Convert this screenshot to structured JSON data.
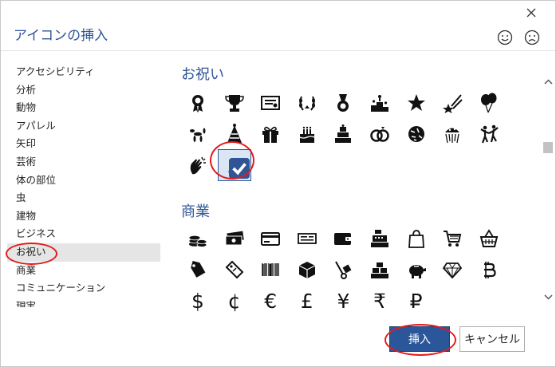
{
  "dialog": {
    "title": "アイコンの挿入",
    "close_icon": "close-icon",
    "feedback_positive_icon": "smile-icon",
    "feedback_negative_icon": "frown-icon"
  },
  "categories": [
    {
      "label": "アクセシビリティ",
      "selected": false
    },
    {
      "label": "分析",
      "selected": false
    },
    {
      "label": "動物",
      "selected": false
    },
    {
      "label": "アパレル",
      "selected": false
    },
    {
      "label": "矢印",
      "selected": false
    },
    {
      "label": "芸術",
      "selected": false
    },
    {
      "label": "体の部位",
      "selected": false
    },
    {
      "label": "虫",
      "selected": false
    },
    {
      "label": "建物",
      "selected": false
    },
    {
      "label": "ビジネス",
      "selected": false
    },
    {
      "label": "お祝い",
      "selected": true
    },
    {
      "label": "商業",
      "selected": false
    },
    {
      "label": "コミュニケーション",
      "selected": false
    },
    {
      "label": "現実",
      "selected": false
    }
  ],
  "sections": [
    {
      "title": "お祝い",
      "icons": [
        "rosette-icon",
        "trophy-icon",
        "certificate-icon",
        "laurel-wreath-icon",
        "medal-icon",
        "podium-icon",
        "star-icon",
        "shooting-star-icon",
        "balloons-icon",
        "balloon-dog-icon",
        "party-hat-icon",
        "gift-icon",
        "birthday-cake-icon",
        "wedding-cake-icon",
        "rings-icon",
        "confetti-icon",
        "confetti-ball-icon",
        "dancing-people-icon",
        "clapping-hands-icon",
        "party-popper-icon"
      ],
      "selected_index": 19
    },
    {
      "title": "商業",
      "icons": [
        "coins-icon",
        "banknotes-icon",
        "credit-card-icon",
        "check-icon",
        "wallet-icon",
        "cash-register-icon",
        "shopping-bag-icon",
        "shopping-cart-icon",
        "shopping-basket-icon",
        "price-tag-icon",
        "tag-icon",
        "barcode-icon",
        "package-icon",
        "hand-truck-icon",
        "gold-bars-icon",
        "piggy-bank-icon",
        "diamond-icon",
        "bitcoin-icon"
      ],
      "currency_glyphs": [
        "$",
        "¢",
        "€",
        "£",
        "¥",
        "₹",
        "₽"
      ]
    }
  ],
  "buttons": {
    "insert_label": "挿入",
    "cancel_label": "キャンセル"
  },
  "colors": {
    "accent": "#2f5597",
    "primary_button": "#2b579a",
    "highlight": "#e01c1c"
  }
}
